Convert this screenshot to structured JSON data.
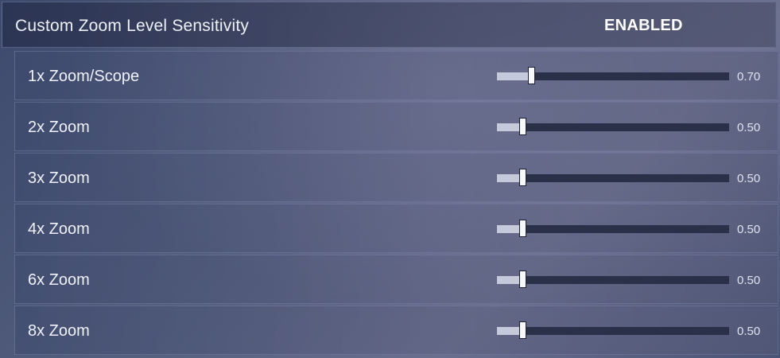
{
  "header": {
    "title": "Custom Zoom Level Sensitivity",
    "status": "ENABLED"
  },
  "rows": [
    {
      "label": "1x Zoom/Scope",
      "value": "0.70",
      "fraction": 0.135
    },
    {
      "label": "2x Zoom",
      "value": "0.50",
      "fraction": 0.095
    },
    {
      "label": "3x Zoom",
      "value": "0.50",
      "fraction": 0.095
    },
    {
      "label": "4x Zoom",
      "value": "0.50",
      "fraction": 0.095
    },
    {
      "label": "6x Zoom",
      "value": "0.50",
      "fraction": 0.095
    },
    {
      "label": "8x Zoom",
      "value": "0.50",
      "fraction": 0.095
    }
  ]
}
